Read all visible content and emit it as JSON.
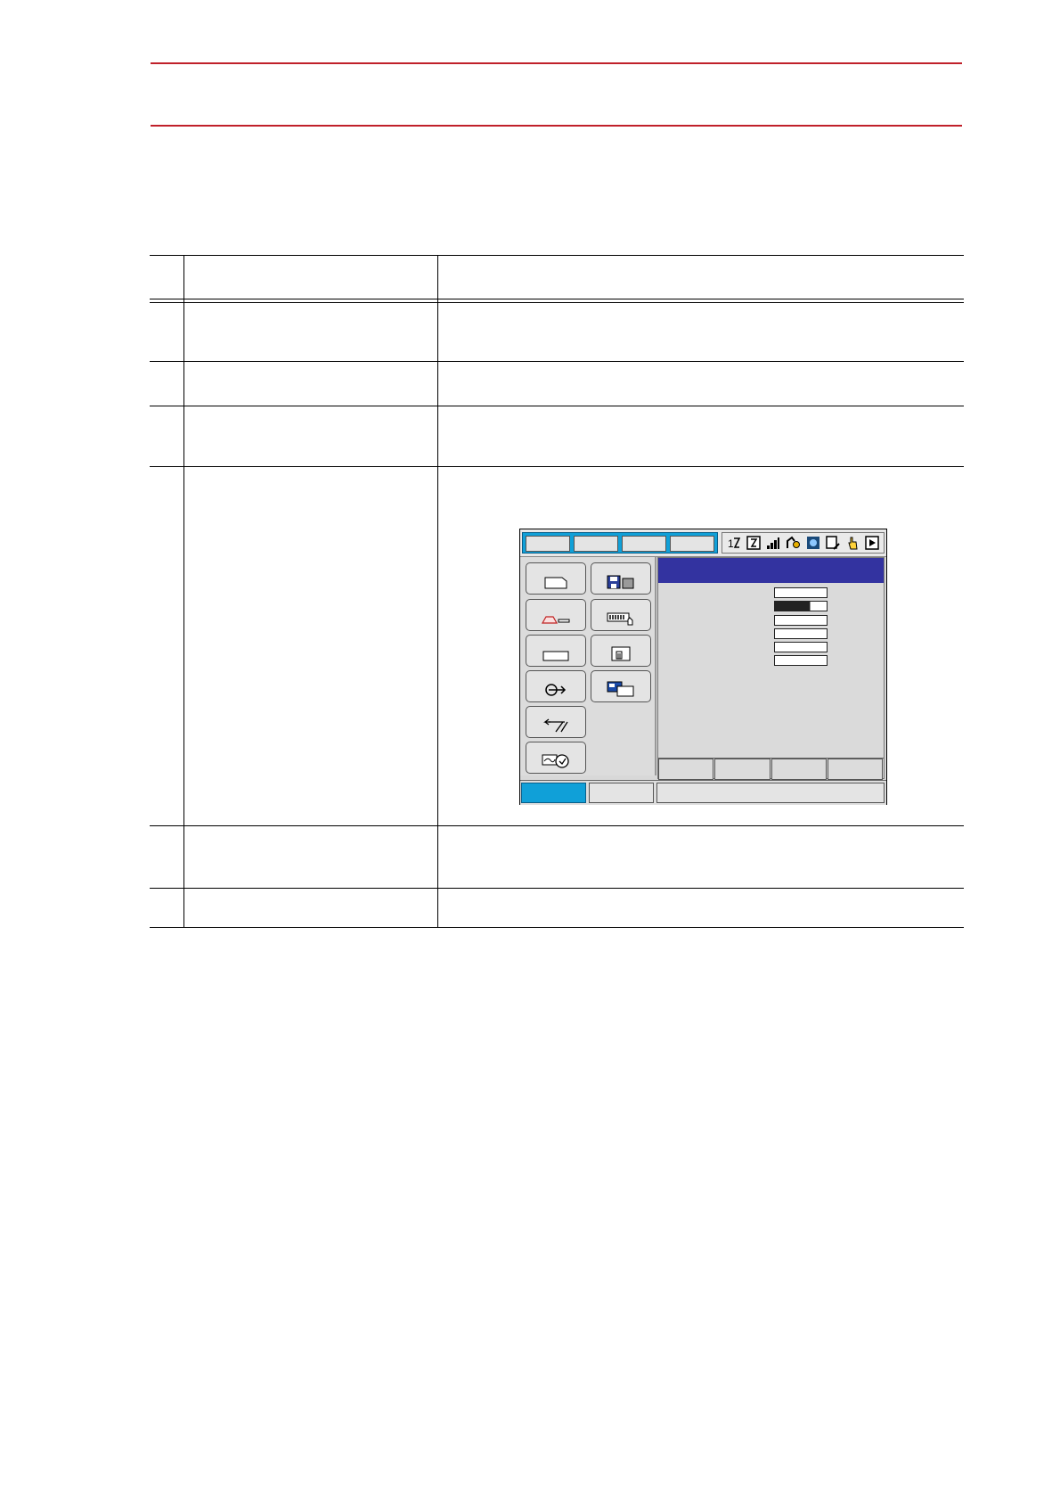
{
  "header": {
    "rule_color": "#c0202a"
  },
  "procedure_table": {
    "line_color": "#000000"
  },
  "pendant_screen": {
    "tab_color": "#10a0d8",
    "title_bar_color": "#3333a0",
    "status_icons": [
      "jog-mode-icon",
      "coordinate-icon",
      "speed-bars-icon",
      "robot-group-icon",
      "security-icon",
      "edit-icon",
      "hand-pointer-icon",
      "play-mode-icon"
    ],
    "main_menu_icons": [
      "job-icon",
      "file-save-icon",
      "robot-icon",
      "io-icon",
      "system-info-icon",
      "variable-icon",
      "arc-welding-icon",
      "display-setup-icon",
      "in-out-icon",
      "setup-clock-icon"
    ],
    "active_field_fill": 0.68
  }
}
